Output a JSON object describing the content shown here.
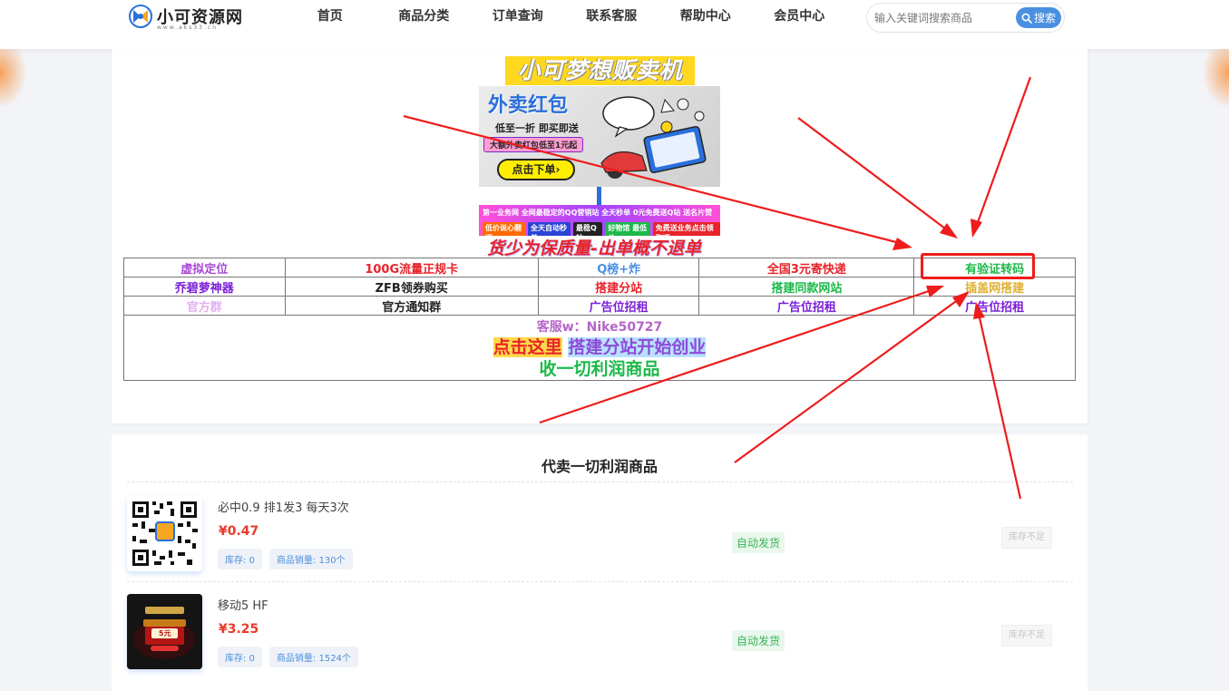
{
  "colors": {
    "accent": "#4a90e2",
    "price": "#e83b2a",
    "auto_badge": "#3bb35b",
    "annotation_red": "#ee1c1c"
  },
  "header": {
    "logo_text": "小可资源网",
    "logo_sub": "www.aks33.cn",
    "nav": [
      "首页",
      "商品分类",
      "订单查询",
      "联系客服",
      "帮助中心",
      "会员中心"
    ],
    "search": {
      "placeholder": "输入关键词搜索商品",
      "button_label": "搜索",
      "button_icon": "search-icon"
    }
  },
  "notice": {
    "banner_title": "小可梦想贩卖机",
    "ad_main": {
      "title": "外卖红包",
      "subtitle": "低至一折 即买即送",
      "pill": "大额外卖红包低至1元起",
      "cta": "点击下单›"
    },
    "ad_strip": {
      "row1": "第一业务网 全网最稳定的QQ营销站 全天秒单 0元免费送Q站 送名片赞",
      "row2": [
        "低价说心翻译",
        "全天自动秒单",
        "最稳Q站",
        "好物馆 最低价",
        "免费送业务点击领取吧"
      ]
    },
    "slogan": "货少为保质量-出单概不退单",
    "table": [
      [
        {
          "text": "虚拟定位",
          "color": "#a94ad6"
        },
        {
          "text": "100G流量正规卡",
          "color": "#e8232a"
        },
        {
          "text": "Q榜+炸",
          "color": "#4a90e2"
        },
        {
          "text": "全国3元寄快递",
          "color": "#e8232a"
        },
        {
          "text": "有验证转码",
          "color": "#1db84a"
        }
      ],
      [
        {
          "text": "乔碧萝神器",
          "color": "#7a1fd6"
        },
        {
          "text": "ZFB领券购买",
          "color": "#222222"
        },
        {
          "text": "搭建分站",
          "color": "#e8232a"
        },
        {
          "text": "搭建同款网站",
          "color": "#1db84a"
        },
        {
          "text": "插盖网搭建",
          "color": "#e0b030"
        }
      ],
      [
        {
          "text": "官方群",
          "color": "#e2b0f0"
        },
        {
          "text": "官方通知群",
          "color": "#222222"
        },
        {
          "text": "广告位招租",
          "color": "#7a1fd6"
        },
        {
          "text": "广告位招租",
          "color": "#7a1fd6"
        },
        {
          "text": "广告位招租",
          "color": "#7a1fd6"
        }
      ]
    ],
    "customer_service": "客服w：Nike50727",
    "start_line_a": "点击这里",
    "start_line_b": "搭建分站开始创业",
    "collect_line": "收一切利润商品"
  },
  "products_section": {
    "title": "代卖一切利润商品",
    "items": [
      {
        "name": "必中0.9 排1发3 每天3次",
        "price": "¥0.47",
        "stock": "库存: 0",
        "sales": "商品销量: 130个",
        "delivery": "自动发货",
        "action": "库存不足"
      },
      {
        "name": "移动5 HF",
        "price": "¥3.25",
        "stock": "库存: 0",
        "sales": "商品销量: 1524个",
        "delivery": "自动发货",
        "action": "库存不足",
        "thumb_badge": "5元"
      }
    ]
  }
}
